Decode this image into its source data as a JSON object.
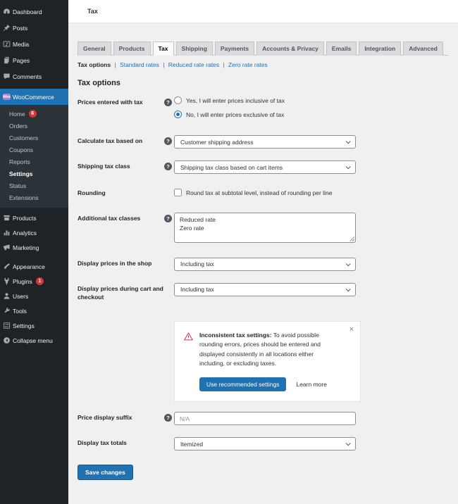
{
  "colors": {
    "accent_blue": "#2271b1",
    "sidebar_bg": "#1d2327",
    "submenu_bg": "#2c3338",
    "badge_red": "#d63638",
    "woo_purple": "#a584d8",
    "warning_red": "#d63638",
    "content_bg": "#f0f0f1"
  },
  "sidebar": {
    "top_items": [
      {
        "label": "Dashboard",
        "icon": "dashboard-icon"
      },
      {
        "label": "Posts",
        "icon": "pushpin-icon"
      },
      {
        "label": "Media",
        "icon": "media-icon"
      },
      {
        "label": "Pages",
        "icon": "pages-icon"
      },
      {
        "label": "Comments",
        "icon": "comments-icon"
      }
    ],
    "woocommerce": {
      "label": "WooCommerce",
      "icon": "woocommerce-icon",
      "logo_text": "Woo"
    },
    "woo_submenu": [
      {
        "label": "Home",
        "badge": "6"
      },
      {
        "label": "Orders"
      },
      {
        "label": "Customers"
      },
      {
        "label": "Coupons"
      },
      {
        "label": "Reports"
      },
      {
        "label": "Settings",
        "current": true
      },
      {
        "label": "Status"
      },
      {
        "label": "Extensions"
      }
    ],
    "bottom_items": [
      {
        "label": "Products",
        "icon": "products-icon"
      },
      {
        "label": "Analytics",
        "icon": "analytics-icon"
      },
      {
        "label": "Marketing",
        "icon": "marketing-icon"
      },
      {
        "label": "Appearance",
        "icon": "appearance-icon"
      },
      {
        "label": "Plugins",
        "icon": "plugins-icon",
        "badge": "1"
      },
      {
        "label": "Users",
        "icon": "users-icon"
      },
      {
        "label": "Tools",
        "icon": "tools-icon"
      },
      {
        "label": "Settings",
        "icon": "settings-icon"
      },
      {
        "label": "Collapse menu",
        "icon": "collapse-icon"
      }
    ]
  },
  "topbar": {
    "breadcrumb": "Tax"
  },
  "tabs": [
    {
      "label": "General"
    },
    {
      "label": "Products"
    },
    {
      "label": "Tax",
      "active": true
    },
    {
      "label": "Shipping"
    },
    {
      "label": "Payments"
    },
    {
      "label": "Accounts & Privacy"
    },
    {
      "label": "Emails"
    },
    {
      "label": "Integration"
    },
    {
      "label": "Advanced"
    }
  ],
  "subnav": {
    "separator": "|",
    "items": [
      {
        "label": "Tax options",
        "current": true
      },
      {
        "label": "Standard rates"
      },
      {
        "label": "Reduced rate rates"
      },
      {
        "label": "Zero rate rates"
      }
    ]
  },
  "page_title": "Tax options",
  "form": {
    "prices_entered": {
      "label": "Prices entered with tax",
      "options": [
        {
          "label": "Yes, I will enter prices inclusive of tax",
          "selected": false
        },
        {
          "label": "No, I will enter prices exclusive of tax",
          "selected": true
        }
      ]
    },
    "calculate_tax": {
      "label": "Calculate tax based on",
      "value": "Customer shipping address"
    },
    "shipping_tax_class": {
      "label": "Shipping tax class",
      "value": "Shipping tax class based on cart items"
    },
    "rounding": {
      "label": "Rounding",
      "option": "Round tax at subtotal level, instead of rounding per line",
      "checked": false
    },
    "additional_tax_classes": {
      "label": "Additional tax classes",
      "value": "Reduced rate\nZero rate"
    },
    "display_prices_shop": {
      "label": "Display prices in the shop",
      "value": "Including tax"
    },
    "display_prices_cart": {
      "label": "Display prices during cart and checkout",
      "value": "Including tax"
    },
    "price_display_suffix": {
      "label": "Price display suffix",
      "placeholder": "N/A"
    },
    "display_tax_totals": {
      "label": "Display tax totals",
      "value": "Itemized"
    }
  },
  "notice": {
    "icon": "warning-triangle-icon",
    "title": "Inconsistent tax settings:",
    "body": "To avoid possible rounding errors, prices should be entered and displayed consistently in all locations either including, or excluding taxes.",
    "primary_button": "Use recommended settings",
    "secondary_button": "Learn more",
    "close_label": "×"
  },
  "save_button": "Save changes"
}
